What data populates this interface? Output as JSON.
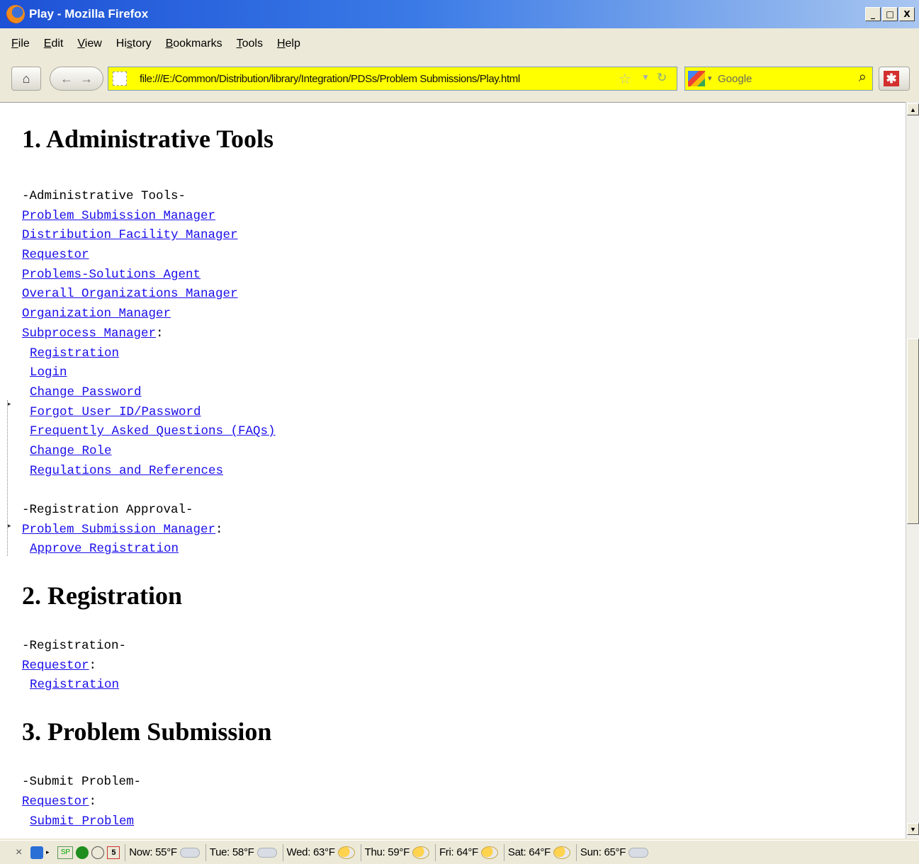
{
  "window": {
    "title": "Play - Mozilla Firefox",
    "controls": [
      "_",
      "□",
      "X"
    ]
  },
  "menubar": [
    {
      "label": "File",
      "key": "F",
      "rest": "ile"
    },
    {
      "label": "Edit",
      "key": "E",
      "rest": "dit"
    },
    {
      "label": "View",
      "key": "V",
      "rest": "iew"
    },
    {
      "label": "History",
      "key": "s",
      "pre": "Hi",
      "rest": "tory"
    },
    {
      "label": "Bookmarks",
      "key": "B",
      "rest": "ookmarks"
    },
    {
      "label": "Tools",
      "key": "T",
      "rest": "ools"
    },
    {
      "label": "Help",
      "key": "H",
      "rest": "elp"
    }
  ],
  "navbar": {
    "url": "file:///E:/Common/Distribution/library/Integration/PDSs/Problem Submissions/Play.html",
    "search_placeholder": "Google",
    "icons": [
      "home-icon",
      "back-icon",
      "forward-icon",
      "site-identity-icon",
      "bookmark-star-icon",
      "history-dropdown-icon",
      "reload-icon",
      "google-logo-icon",
      "search-icon",
      "addon-icon"
    ]
  },
  "page": {
    "sections": [
      {
        "heading": "1. Administrative Tools",
        "groups": [
          {
            "title": "-Administrative Tools-",
            "lines": [
              {
                "link": "Problem Submission Manager"
              },
              {
                "link": "Distribution Facility Manager"
              },
              {
                "link": "Requestor"
              },
              {
                "link": "Problems-Solutions Agent"
              },
              {
                "link": "Overall Organizations Manager"
              },
              {
                "link": "Organization Manager"
              },
              {
                "link": "Subprocess Manager",
                "suffix": ":"
              },
              {
                "link": "Registration",
                "indent": true
              },
              {
                "link": "Login",
                "indent": true
              },
              {
                "link": "Change Password",
                "indent": true
              },
              {
                "link": "Forgot User ID/Password",
                "indent": true
              },
              {
                "link": "Frequently Asked Questions (FAQs)",
                "indent": true
              },
              {
                "link": "Change Role",
                "indent": true
              },
              {
                "link": "Regulations and References",
                "indent": true
              }
            ]
          },
          {
            "title": "-Registration Approval-",
            "lines": [
              {
                "link": "Problem Submission Manager",
                "suffix": ":"
              },
              {
                "link": "Approve Registration",
                "indent": true
              }
            ]
          }
        ]
      },
      {
        "heading": "2. Registration",
        "groups": [
          {
            "title": "-Registration-",
            "lines": [
              {
                "link": "Requestor",
                "suffix": ":"
              },
              {
                "link": "Registration",
                "indent": true
              }
            ]
          }
        ]
      },
      {
        "heading": "3. Problem Submission",
        "groups": [
          {
            "title": "-Submit Problem-",
            "lines": [
              {
                "link": "Requestor",
                "suffix": ":"
              },
              {
                "link": "Submit Problem",
                "indent": true
              }
            ]
          }
        ]
      }
    ]
  },
  "statusbar": {
    "close": "×",
    "sp_label": "SP",
    "calendar_day": "5",
    "weather": [
      {
        "label": "Now: 55°F",
        "icon": "cloud"
      },
      {
        "label": "Tue: 58°F",
        "icon": "rain"
      },
      {
        "label": "Wed: 63°F",
        "icon": "partly-sunny"
      },
      {
        "label": "Thu: 59°F",
        "icon": "sunny"
      },
      {
        "label": "Fri: 64°F",
        "icon": "sunny"
      },
      {
        "label": "Sat: 64°F",
        "icon": "sunny"
      },
      {
        "label": "Sun: 65°F",
        "icon": "cloud"
      }
    ]
  }
}
